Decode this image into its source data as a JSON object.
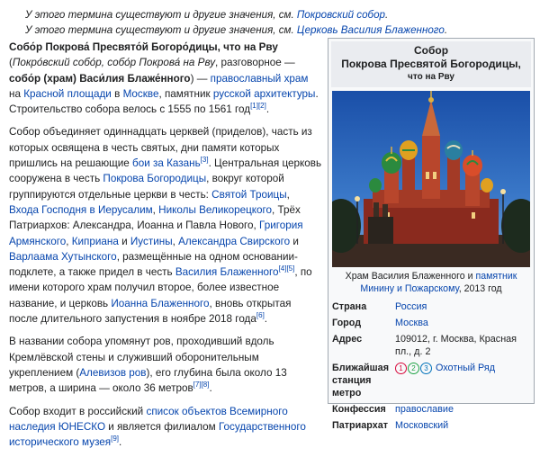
{
  "hatnotes": {
    "line1_prefix": "У этого термина существуют и другие значения, см. ",
    "line1_link": "Покровский собор",
    "line1_suffix": ".",
    "line2_prefix": "У этого термина существуют и другие значения, см. ",
    "line2_link": "Церковь Василия Блаженного",
    "line2_suffix": "."
  },
  "article": {
    "p1": {
      "b1": "Собо́р Покрова́ Пресвято́й Богоро́дицы, что на Рву",
      "t1": " (",
      "i1": "Покро́вский собо́р, собо́р Покрова́ на Рву",
      "t2": ", разговорное — ",
      "b2": "собо́р (храм) Васи́лия Блаже́нного",
      "t3": ") — ",
      "l1": "православный храм",
      "t4": " на ",
      "l2": "Красной площади",
      "t5": " в ",
      "l3": "Москве",
      "t6": ", памятник ",
      "l4": "русской архитектуры",
      "t7": ". Строительство собора велось с 1555 по 1561 год",
      "s1": "[1][2]",
      "t8": "."
    },
    "p2": {
      "t1": "Собор объединяет одиннадцать церквей (приделов), часть из которых освящена в честь святых, дни памяти которых пришлись на решающие ",
      "l1": "бои за Казань",
      "s1": "[3]",
      "t2": ". Центральная церковь сооружена в честь ",
      "l2": "Покрова Богородицы",
      "t3": ", вокруг которой группируются отдельные церкви в честь: ",
      "l3": "Святой Троицы",
      "t4": ", ",
      "l4": "Входа Господня в Иерусалим",
      "t5": ", ",
      "l5": "Николы Великорецкого",
      "t6": ", Трёх Патриархов: Александра, Иоанна и Павла Нового, ",
      "l6": "Григория Армянского",
      "t7": ", ",
      "l7": "Киприана",
      "t8": " и ",
      "l8": "Иустины",
      "t9": ", ",
      "l9": "Александра Свирского",
      "t10": " и ",
      "l10": "Варлаама Хутынского",
      "t11": ", размещённые на одном основании-подклете, а также придел в честь ",
      "l11": "Василия Блаженного",
      "s2": "[4][5]",
      "t12": ", по имени которого храм получил второе, более известное название, и церковь ",
      "l12": "Иоанна Блаженного",
      "t13": ", вновь открытая после длительного запустения в ноябре 2018 года",
      "s3": "[6]",
      "t14": "."
    },
    "p3": {
      "t1": "В названии собора упомянут ров, проходивший вдоль Кремлёвской стены и служивший оборонительным укреплением (",
      "l1": "Алевизов ров",
      "t2": "), его глубина была около 13 метров, а ширина — около 36 метров",
      "s1": "[7][8]",
      "t3": "."
    },
    "p4": {
      "t1": "Собор входит в российский ",
      "l1": "список объектов Всемирного наследия ЮНЕСКО",
      "t2": " и является филиалом ",
      "l2": "Государственного исторического музея",
      "s1": "[9]",
      "t3": "."
    }
  },
  "infobox": {
    "title1": "Собор",
    "title2": "Покрова Пресвятой Богородицы,",
    "title3": "что на Рву",
    "caption_text": "Храм Василия Блаженного и ",
    "caption_link": "памятник Минину и Пожарскому",
    "caption_year": ", 2013 год",
    "rows": [
      {
        "k": "Страна",
        "v": "Россия"
      },
      {
        "k": "Город",
        "v": "Москва"
      },
      {
        "k": "Адрес",
        "v": "109012, г. Москва, Красная пл., д. 2"
      },
      {
        "k": "Ближайшая станция метро",
        "v": "Охотный Ряд",
        "metro": [
          "1",
          "2",
          "3"
        ]
      },
      {
        "k": "Конфессия",
        "v": "православие"
      },
      {
        "k": "Патриархат",
        "v": "Московский"
      }
    ]
  },
  "colors": {
    "link": "#0645ad",
    "metro1": "#d6083b",
    "metro2": "#1fa345",
    "metro3": "#0072ba"
  }
}
